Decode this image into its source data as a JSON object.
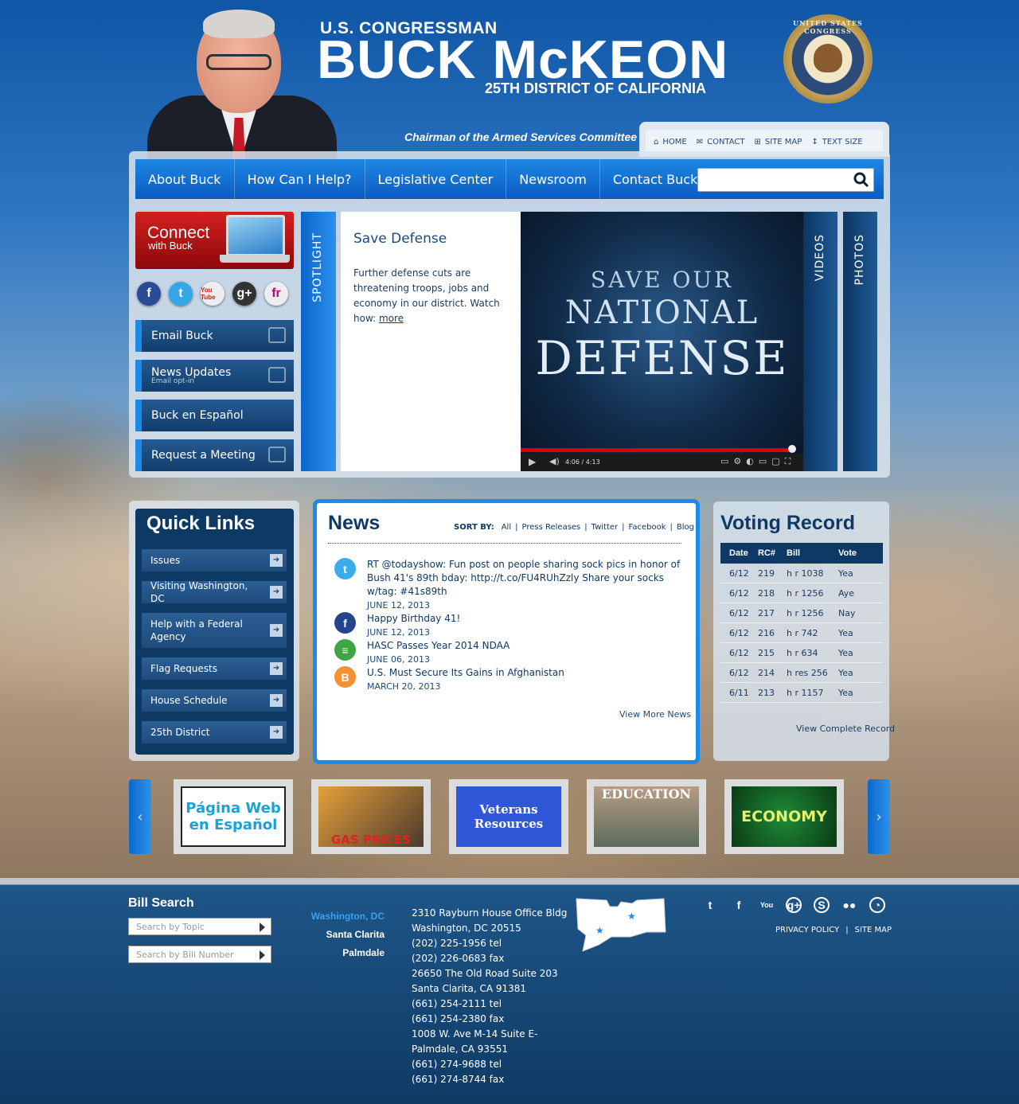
{
  "header": {
    "title_small": "U.S. CONGRESSMAN",
    "title_big": "BUCK McKEON",
    "district": "25TH DISTRICT OF CALIFORNIA",
    "chairman": "Chairman of the Armed Services Committee",
    "seal_text": "UNITED STATES CONGRESS"
  },
  "utility": {
    "home": "HOME",
    "contact": "CONTACT",
    "sitemap": "SITE MAP",
    "textsize": "TEXT SIZE"
  },
  "nav": [
    "About Buck",
    "How Can I Help?",
    "Legislative Center",
    "Newsroom",
    "Contact Buck"
  ],
  "search": {
    "placeholder": ""
  },
  "connect": {
    "title": "Connect",
    "subtitle": "with Buck"
  },
  "socials": [
    "f",
    "t",
    "You Tube",
    "g+",
    "fr"
  ],
  "side_buttons": [
    {
      "label": "Email Buck",
      "sub": ""
    },
    {
      "label": "News Updates",
      "sub": "Email opt-in"
    },
    {
      "label": "Buck en Español",
      "sub": ""
    },
    {
      "label": "Request a Meeting",
      "sub": ""
    }
  ],
  "spotlight": {
    "label": "SPOTLIGHT",
    "title": "Save Defense",
    "body": "Further defense cuts are threatening troops, jobs and economy in our district. Watch how: ",
    "more": "more"
  },
  "video": {
    "line1": "SAVE OUR",
    "line2": "NATIONAL",
    "line3": "DEFENSE",
    "time": "4:06 / 4:13",
    "progress": 0.96
  },
  "tabs": {
    "videos": "VIDEOS",
    "photos": "PHOTOS"
  },
  "quick_links": {
    "title": "Quick Links",
    "items": [
      "Issues",
      "Visiting Washington, DC",
      "Help with a Federal Agency",
      "Flag Requests",
      "House Schedule",
      "25th District"
    ]
  },
  "news": {
    "title": "News",
    "sort_label": "SORT BY:",
    "sort_options": [
      "All",
      "Press Releases",
      "Twitter",
      "Facebook",
      "Blog"
    ],
    "items": [
      {
        "icon": "twitter",
        "text": "RT @todayshow: Fun post on people sharing sock pics in honor of Bush 41's 89th bday: http://t.co/FU4RUhZzly Share your socks w/tag: #41s89th",
        "date": "JUNE 12, 2013"
      },
      {
        "icon": "facebook",
        "text": "Happy Birthday 41!",
        "date": "JUNE 12, 2013"
      },
      {
        "icon": "press-release",
        "text": "HASC Passes Year 2014 NDAA",
        "date": "JUNE 06, 2013"
      },
      {
        "icon": "blog",
        "text": "U.S. Must Secure Its Gains in Afghanistan",
        "date": "MARCH 20, 2013"
      }
    ],
    "view_more": "View More News"
  },
  "voting": {
    "title": "Voting Record",
    "headers": [
      "Date",
      "RC#",
      "Bill",
      "Vote"
    ],
    "rows": [
      [
        "6/12",
        "219",
        "h r 1038",
        "Yea"
      ],
      [
        "6/12",
        "218",
        "h r 1256",
        "Aye"
      ],
      [
        "6/12",
        "217",
        "h r 1256",
        "Nay"
      ],
      [
        "6/12",
        "216",
        "h r 742",
        "Yea"
      ],
      [
        "6/12",
        "215",
        "h r 634",
        "Yea"
      ],
      [
        "6/12",
        "214",
        "h res 256",
        "Yea"
      ],
      [
        "6/11",
        "213",
        "h r 1157",
        "Yea"
      ]
    ],
    "link": "View Complete Record"
  },
  "carousel": [
    {
      "text": "Página Web en Español",
      "bg": "#ffffff",
      "fg": "#1aa2d8"
    },
    {
      "text": "GAS PRICES",
      "bg": "#7a4a22",
      "fg": "#e2221f"
    },
    {
      "text": "Veterans Resources",
      "bg": "#2f57d8",
      "fg": "#ffffff"
    },
    {
      "text": "EDUCATION",
      "bg": "#8d7b6a",
      "fg": "#ffffff"
    },
    {
      "text": "ECONOMY",
      "bg": "#0f5a1f",
      "fg": "#e5f06e"
    }
  ],
  "footer": {
    "bill_search": "Bill Search",
    "topic_placeholder": "Search by Topic",
    "number_placeholder": "Search by Bill Number",
    "offices": [
      "Washington, DC",
      "Santa Clarita",
      "Palmdale"
    ],
    "address_lines": [
      "2310 Rayburn House Office Bldg",
      "Washington, DC 20515",
      "(202) 225-1956 tel",
      "(202) 226-0683 fax",
      "26650 The Old Road Suite 203",
      "Santa Clarita, CA 91381",
      "(661) 254-2111 tel",
      "(661) 254-2380 fax",
      "1008 W. Ave M-14 Suite E-",
      "Palmdale, CA 93551",
      "(661) 274-9688 tel",
      "(661) 274-8744 fax"
    ],
    "privacy": "PRIVACY POLICY",
    "sitemap": "SITE MAP",
    "social_icons": [
      "twitter-icon",
      "facebook-icon",
      "youtube-icon",
      "google-plus-icon",
      "skype-icon",
      "flickr-icon",
      "rss-icon"
    ]
  },
  "colors": {
    "accent": "#1b8ae8",
    "navy": "#0e3964",
    "red": "#c41a26"
  }
}
